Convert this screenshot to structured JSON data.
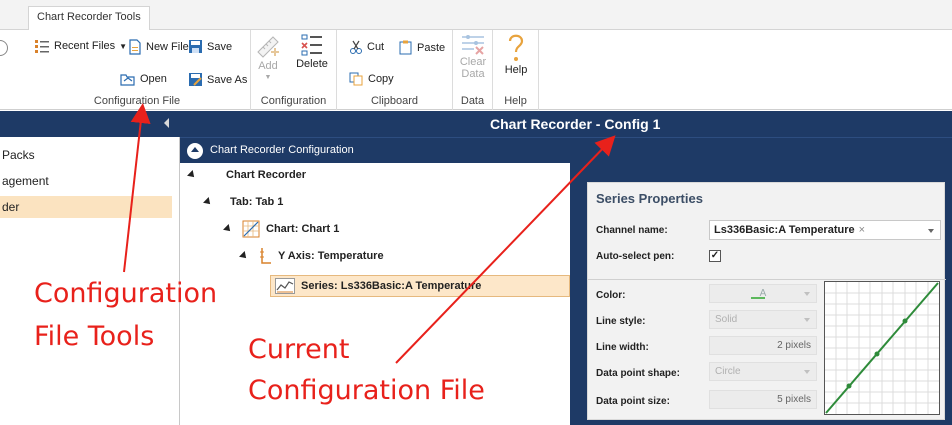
{
  "ribbon": {
    "tab": "Chart Recorder Tools",
    "groups": {
      "configuration_file": {
        "label": "Configuration File",
        "recent_files": "Recent Files",
        "new_file": "New File",
        "save": "Save",
        "open": "Open",
        "save_as": "Save As"
      },
      "configuration": {
        "label": "Configuration",
        "add": "Add",
        "delete": "Delete"
      },
      "clipboard": {
        "label": "Clipboard",
        "cut": "Cut",
        "paste": "Paste",
        "copy": "Copy"
      },
      "data": {
        "label": "Data",
        "clear_line1": "Clear",
        "clear_line2": "Data"
      },
      "help": {
        "label": "Help",
        "help": "Help"
      }
    }
  },
  "header": {
    "title": "Chart Recorder - Config 1"
  },
  "left_nav": {
    "items": [
      {
        "label": "Packs",
        "selected": false
      },
      {
        "label": "agement",
        "selected": false
      },
      {
        "label": "der",
        "selected": true
      }
    ]
  },
  "config_panel": {
    "title": "Chart Recorder Configuration",
    "tree": {
      "root": "Chart Recorder",
      "tab": "Tab: Tab 1",
      "chart": "Chart: Chart 1",
      "y_axis": "Y Axis: Temperature",
      "series": "Series: Ls336Basic:A Temperature"
    }
  },
  "series_properties": {
    "title": "Series Properties",
    "channel_name": {
      "label": "Channel name:",
      "value": "Ls336Basic:A Temperature",
      "remove": "×"
    },
    "auto_select_pen": {
      "label": "Auto-select pen:",
      "checked": true,
      "mark": "✓"
    },
    "color": {
      "label": "Color:",
      "glyph": "A",
      "value": "#5cb85c"
    },
    "line_style": {
      "label": "Line style:",
      "value": "Solid"
    },
    "line_width": {
      "label": "Line width:",
      "value": "2 pixels"
    },
    "data_point_shape": {
      "label": "Data point shape:",
      "value": "Circle"
    },
    "data_point_size": {
      "label": "Data point size:",
      "value": "5 pixels"
    }
  },
  "annotations": {
    "config_file_tools": [
      "Configuration",
      "File Tools"
    ],
    "current_config_file": [
      "Current",
      "Configuration File"
    ],
    "color": "#e8211b"
  }
}
